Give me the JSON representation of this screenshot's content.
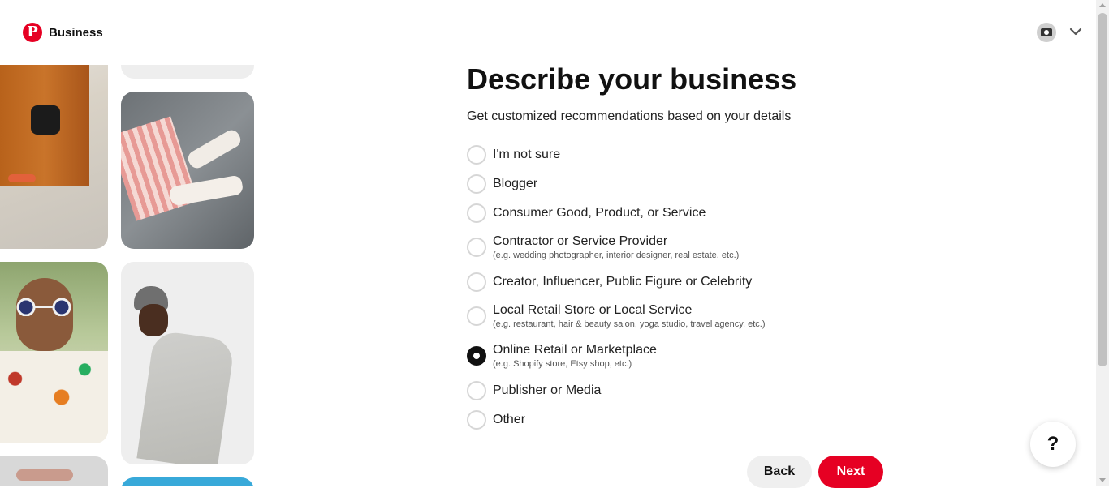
{
  "header": {
    "logo_letter": "P",
    "brand": "Business",
    "avatar_icon": "camera-icon",
    "menu_icon": "chevron-down-icon"
  },
  "main": {
    "title": "Describe your business",
    "subtitle": "Get customized recommendations based on your details",
    "selected_option": "Online Retail or Marketplace",
    "options": [
      {
        "label": "I'm not sure",
        "hint": "",
        "checked": false
      },
      {
        "label": "Blogger",
        "hint": "",
        "checked": false
      },
      {
        "label": "Consumer Good, Product, or Service",
        "hint": "",
        "checked": false
      },
      {
        "label": "Contractor or Service Provider",
        "hint": "(e.g. wedding photographer, interior designer, real estate, etc.)",
        "checked": false
      },
      {
        "label": "Creator, Influencer, Public Figure or Celebrity",
        "hint": "",
        "checked": false
      },
      {
        "label": "Local Retail Store or Local Service",
        "hint": "(e.g. restaurant, hair & beauty salon, yoga studio, travel agency, etc.)",
        "checked": false
      },
      {
        "label": "Online Retail or Marketplace",
        "hint": "(e.g. Shopify store, Etsy shop, etc.)",
        "checked": true
      },
      {
        "label": "Publisher or Media",
        "hint": "",
        "checked": false
      },
      {
        "label": "Other",
        "hint": "",
        "checked": false
      }
    ]
  },
  "footer": {
    "back_label": "Back",
    "next_label": "Next",
    "help_label": "?"
  },
  "colors": {
    "brand_red": "#e60023",
    "text": "#111111",
    "radio_border": "#d6d6d6",
    "back_bg": "#efefef"
  }
}
